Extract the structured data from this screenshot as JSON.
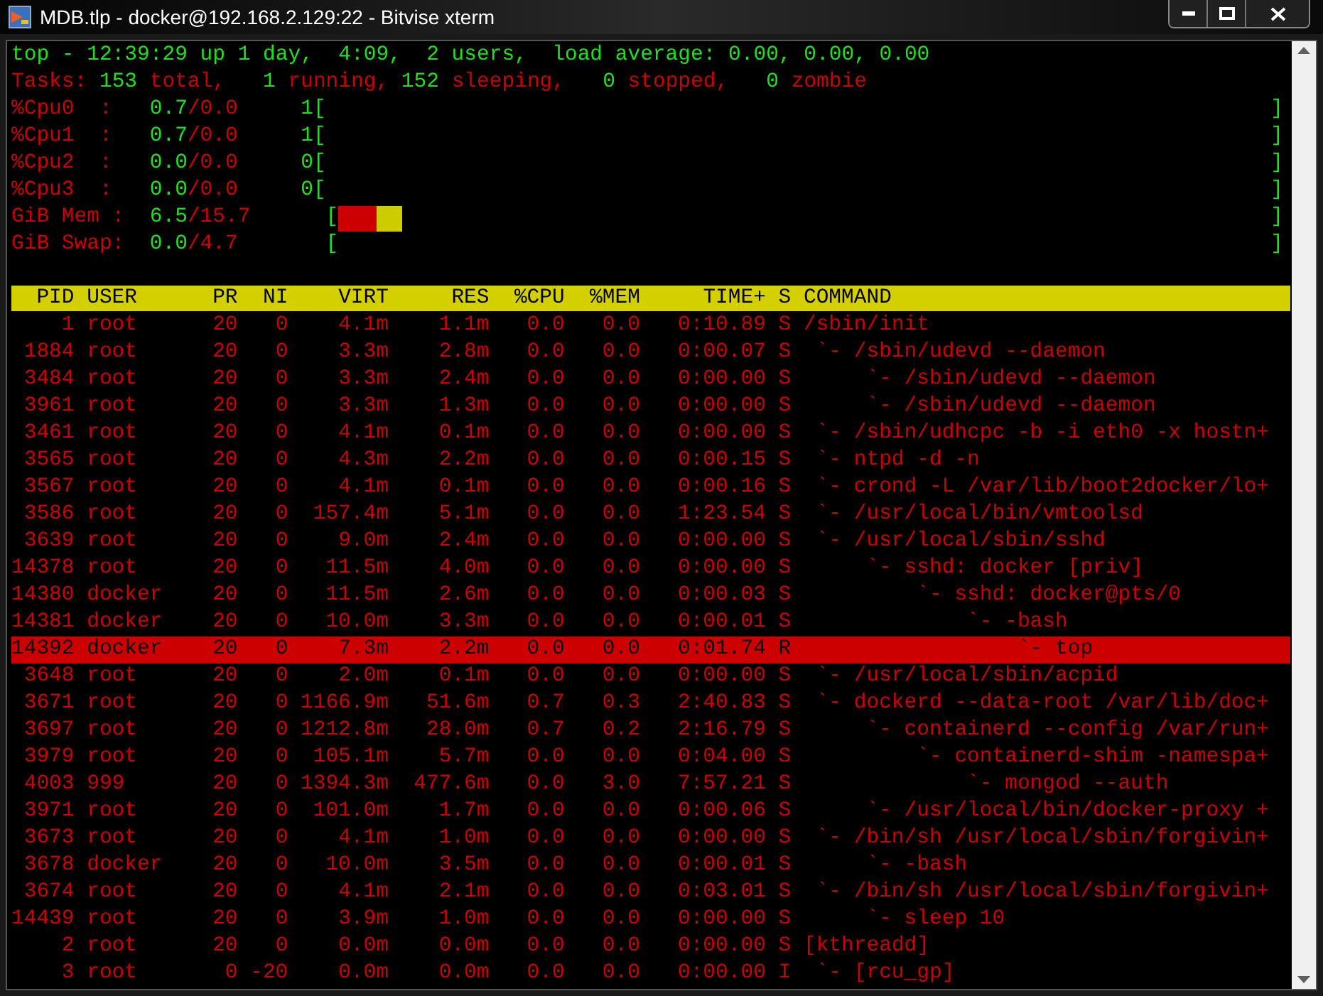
{
  "window": {
    "title": "MDB.tlp - docker@192.168.2.129:22 - Bitvise xterm"
  },
  "summary": [
    {
      "segments": [
        {
          "text": "top - 12:39:29 up 1 day,  4:09,  2 users,  load average: 0.00, 0.00, 0.00",
          "kind": "value"
        }
      ]
    },
    {
      "segments": [
        {
          "text": "Tasks: ",
          "kind": "label"
        },
        {
          "text": "153",
          "kind": "value"
        },
        {
          "text": " total,   ",
          "kind": "label"
        },
        {
          "text": "1",
          "kind": "value"
        },
        {
          "text": " running, ",
          "kind": "label"
        },
        {
          "text": "152",
          "kind": "value"
        },
        {
          "text": " sleeping,   ",
          "kind": "label"
        },
        {
          "text": "0",
          "kind": "value"
        },
        {
          "text": " stopped,   ",
          "kind": "label"
        },
        {
          "text": "0",
          "kind": "value"
        },
        {
          "text": " zombie",
          "kind": "label"
        }
      ]
    }
  ],
  "meters": [
    {
      "segments": [
        {
          "text": "%Cpu0  :   ",
          "kind": "label"
        },
        {
          "text": "0.7",
          "kind": "value"
        },
        {
          "text": "/0.0",
          "kind": "label"
        },
        {
          "text": "     1[",
          "kind": "value"
        }
      ],
      "close": "]"
    },
    {
      "segments": [
        {
          "text": "%Cpu1  :   ",
          "kind": "label"
        },
        {
          "text": "0.7",
          "kind": "value"
        },
        {
          "text": "/0.0",
          "kind": "label"
        },
        {
          "text": "     1[",
          "kind": "value"
        }
      ],
      "close": "]"
    },
    {
      "segments": [
        {
          "text": "%Cpu2  :   ",
          "kind": "label"
        },
        {
          "text": "0.0",
          "kind": "value"
        },
        {
          "text": "/0.0",
          "kind": "label"
        },
        {
          "text": "     0[",
          "kind": "value"
        }
      ],
      "close": "]"
    },
    {
      "segments": [
        {
          "text": "%Cpu3  :   ",
          "kind": "label"
        },
        {
          "text": "0.0",
          "kind": "value"
        },
        {
          "text": "/0.0",
          "kind": "label"
        },
        {
          "text": "     0[",
          "kind": "value"
        }
      ],
      "close": "]"
    },
    {
      "segments": [
        {
          "text": "GiB Mem :  ",
          "kind": "label"
        },
        {
          "text": "6.5",
          "kind": "value"
        },
        {
          "text": "/15.7",
          "kind": "label"
        },
        {
          "text": "      [",
          "kind": "value"
        }
      ],
      "bars": [
        {
          "level": 0.041,
          "color": "#cc0000"
        },
        {
          "level": 0.027,
          "color": "#cccc00"
        }
      ],
      "close": "]"
    },
    {
      "segments": [
        {
          "text": "GiB Swap:  ",
          "kind": "label"
        },
        {
          "text": "0.0",
          "kind": "value"
        },
        {
          "text": "/4.7",
          "kind": "label"
        },
        {
          "text": "       [",
          "kind": "value"
        }
      ],
      "close": "]"
    }
  ],
  "table": {
    "columns": [
      "PID",
      "USER",
      "PR",
      "NI",
      "VIRT",
      "RES",
      "%CPU",
      "%MEM",
      "TIME+",
      "S",
      "COMMAND"
    ],
    "rows": [
      {
        "pid": "1",
        "user": "root",
        "pr": "20",
        "ni": "0",
        "virt": "4.1m",
        "res": "1.1m",
        "cpu": "0.0",
        "mem": "0.0",
        "time": "0:10.89",
        "s": "S",
        "command": "/sbin/init",
        "selected": false,
        "children": [
          {
            "pid": "1884",
            "user": "root",
            "pr": "20",
            "ni": "0",
            "virt": "3.3m",
            "res": "2.8m",
            "cpu": "0.0",
            "mem": "0.0",
            "time": "0:00.07",
            "s": "S",
            "command": "`- /sbin/udevd --daemon",
            "selected": false,
            "children": [
              {
                "pid": "3484",
                "user": "root",
                "pr": "20",
                "ni": "0",
                "virt": "3.3m",
                "res": "2.4m",
                "cpu": "0.0",
                "mem": "0.0",
                "time": "0:00.00",
                "s": "S",
                "command": "`- /sbin/udevd --daemon",
                "selected": false
              },
              {
                "pid": "3961",
                "user": "root",
                "pr": "20",
                "ni": "0",
                "virt": "3.3m",
                "res": "1.3m",
                "cpu": "0.0",
                "mem": "0.0",
                "time": "0:00.00",
                "s": "S",
                "command": "`- /sbin/udevd --daemon",
                "selected": false
              }
            ]
          },
          {
            "pid": "3461",
            "user": "root",
            "pr": "20",
            "ni": "0",
            "virt": "4.1m",
            "res": "0.1m",
            "cpu": "0.0",
            "mem": "0.0",
            "time": "0:00.00",
            "s": "S",
            "command": "`- /sbin/udhcpc -b -i eth0 -x hostn+",
            "selected": false
          },
          {
            "pid": "3565",
            "user": "root",
            "pr": "20",
            "ni": "0",
            "virt": "4.3m",
            "res": "2.2m",
            "cpu": "0.0",
            "mem": "0.0",
            "time": "0:00.15",
            "s": "S",
            "command": "`- ntpd -d -n",
            "selected": false
          },
          {
            "pid": "3567",
            "user": "root",
            "pr": "20",
            "ni": "0",
            "virt": "4.1m",
            "res": "0.1m",
            "cpu": "0.0",
            "mem": "0.0",
            "time": "0:00.16",
            "s": "S",
            "command": "`- crond -L /var/lib/boot2docker/lo+",
            "selected": false
          },
          {
            "pid": "3586",
            "user": "root",
            "pr": "20",
            "ni": "0",
            "virt": "157.4m",
            "res": "5.1m",
            "cpu": "0.0",
            "mem": "0.0",
            "time": "1:23.54",
            "s": "S",
            "command": "`- /usr/local/bin/vmtoolsd",
            "selected": false
          },
          {
            "pid": "3639",
            "user": "root",
            "pr": "20",
            "ni": "0",
            "virt": "9.0m",
            "res": "2.4m",
            "cpu": "0.0",
            "mem": "0.0",
            "time": "0:00.00",
            "s": "S",
            "command": "`- /usr/local/sbin/sshd",
            "selected": false,
            "children": [
              {
                "pid": "14378",
                "user": "root",
                "pr": "20",
                "ni": "0",
                "virt": "11.5m",
                "res": "4.0m",
                "cpu": "0.0",
                "mem": "0.0",
                "time": "0:00.00",
                "s": "S",
                "command": "`- sshd: docker [priv]",
                "selected": false,
                "children": [
                  {
                    "pid": "14380",
                    "user": "docker",
                    "pr": "20",
                    "ni": "0",
                    "virt": "11.5m",
                    "res": "2.6m",
                    "cpu": "0.0",
                    "mem": "0.0",
                    "time": "0:00.03",
                    "s": "S",
                    "command": "`- sshd: docker@pts/0",
                    "selected": false,
                    "children": [
                      {
                        "pid": "14381",
                        "user": "docker",
                        "pr": "20",
                        "ni": "0",
                        "virt": "10.0m",
                        "res": "3.3m",
                        "cpu": "0.0",
                        "mem": "0.0",
                        "time": "0:00.01",
                        "s": "S",
                        "command": "`- -bash",
                        "selected": false,
                        "children": [
                          {
                            "pid": "14392",
                            "user": "docker",
                            "pr": "20",
                            "ni": "0",
                            "virt": "7.3m",
                            "res": "2.2m",
                            "cpu": "0.0",
                            "mem": "0.0",
                            "time": "0:01.74",
                            "s": "R",
                            "command": "`- top",
                            "selected": true
                          }
                        ]
                      }
                    ]
                  }
                ]
              }
            ]
          },
          {
            "pid": "3648",
            "user": "root",
            "pr": "20",
            "ni": "0",
            "virt": "2.0m",
            "res": "0.1m",
            "cpu": "0.0",
            "mem": "0.0",
            "time": "0:00.00",
            "s": "S",
            "command": "`- /usr/local/sbin/acpid",
            "selected": false
          },
          {
            "pid": "3671",
            "user": "root",
            "pr": "20",
            "ni": "0",
            "virt": "1166.9m",
            "res": "51.6m",
            "cpu": "0.7",
            "mem": "0.3",
            "time": "2:40.83",
            "s": "S",
            "command": "`- dockerd --data-root /var/lib/doc+",
            "selected": false,
            "children": [
              {
                "pid": "3697",
                "user": "root",
                "pr": "20",
                "ni": "0",
                "virt": "1212.8m",
                "res": "28.0m",
                "cpu": "0.7",
                "mem": "0.2",
                "time": "2:16.79",
                "s": "S",
                "command": "`- containerd --config /var/run+",
                "selected": false,
                "children": [
                  {
                    "pid": "3979",
                    "user": "root",
                    "pr": "20",
                    "ni": "0",
                    "virt": "105.1m",
                    "res": "5.7m",
                    "cpu": "0.0",
                    "mem": "0.0",
                    "time": "0:04.00",
                    "s": "S",
                    "command": "`- containerd-shim -namespa+",
                    "selected": false,
                    "children": [
                      {
                        "pid": "4003",
                        "user": "999",
                        "pr": "20",
                        "ni": "0",
                        "virt": "1394.3m",
                        "res": "477.6m",
                        "cpu": "0.0",
                        "mem": "3.0",
                        "time": "7:57.21",
                        "s": "S",
                        "command": "`- mongod --auth",
                        "selected": false
                      }
                    ]
                  }
                ]
              },
              {
                "pid": "3971",
                "user": "root",
                "pr": "20",
                "ni": "0",
                "virt": "101.0m",
                "res": "1.7m",
                "cpu": "0.0",
                "mem": "0.0",
                "time": "0:00.06",
                "s": "S",
                "command": "`- /usr/local/bin/docker-proxy +",
                "selected": false
              }
            ]
          },
          {
            "pid": "3673",
            "user": "root",
            "pr": "20",
            "ni": "0",
            "virt": "4.1m",
            "res": "1.0m",
            "cpu": "0.0",
            "mem": "0.0",
            "time": "0:00.00",
            "s": "S",
            "command": "`- /bin/sh /usr/local/sbin/forgivin+",
            "selected": false,
            "children": [
              {
                "pid": "3678",
                "user": "docker",
                "pr": "20",
                "ni": "0",
                "virt": "10.0m",
                "res": "3.5m",
                "cpu": "0.0",
                "mem": "0.0",
                "time": "0:00.01",
                "s": "S",
                "command": "`- -bash",
                "selected": false
              }
            ]
          },
          {
            "pid": "3674",
            "user": "root",
            "pr": "20",
            "ni": "0",
            "virt": "4.1m",
            "res": "2.1m",
            "cpu": "0.0",
            "mem": "0.0",
            "time": "0:03.01",
            "s": "S",
            "command": "`- /bin/sh /usr/local/sbin/forgivin+",
            "selected": false,
            "children": [
              {
                "pid": "14439",
                "user": "root",
                "pr": "20",
                "ni": "0",
                "virt": "3.9m",
                "res": "1.0m",
                "cpu": "0.0",
                "mem": "0.0",
                "time": "0:00.00",
                "s": "S",
                "command": "`- sleep 10",
                "selected": false
              }
            ]
          }
        ]
      },
      {
        "pid": "2",
        "user": "root",
        "pr": "20",
        "ni": "0",
        "virt": "0.0m",
        "res": "0.0m",
        "cpu": "0.0",
        "mem": "0.0",
        "time": "0:00.00",
        "s": "S",
        "command": "[kthreadd]",
        "selected": false,
        "children": [
          {
            "pid": "3",
            "user": "root",
            "pr": "0",
            "ni": "-20",
            "virt": "0.0m",
            "res": "0.0m",
            "cpu": "0.0",
            "mem": "0.0",
            "time": "0:00.00",
            "s": "I",
            "command": "`- [rcu_gp]",
            "selected": false
          }
        ]
      }
    ]
  }
}
